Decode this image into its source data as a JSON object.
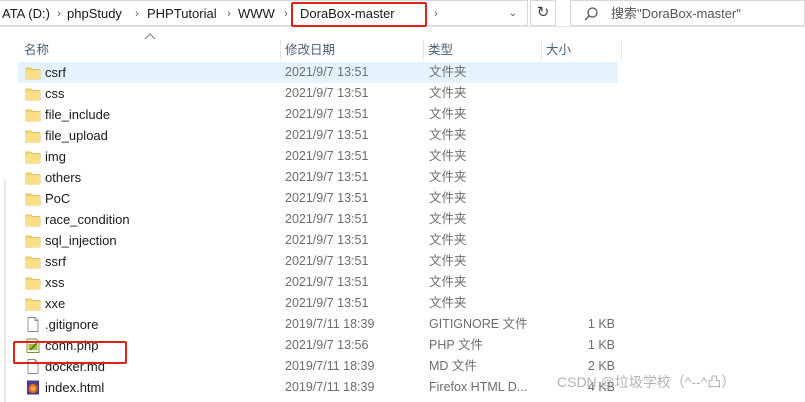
{
  "address": {
    "crumbs": [
      "ATA (D:)",
      "phpStudy",
      "PHPTutorial",
      "WWW",
      "DoraBox-master"
    ],
    "separator": "›",
    "dropdown": "⌄",
    "refresh": "↻"
  },
  "search": {
    "placeholder": "搜索\"DoraBox-master\""
  },
  "columns": {
    "name": "名称",
    "date": "修改日期",
    "type": "类型",
    "size": "大小"
  },
  "files": [
    {
      "name": "csrf",
      "date": "2021/9/7 13:51",
      "type": "文件夹",
      "size": "",
      "icon": "folder-icon"
    },
    {
      "name": "css",
      "date": "2021/9/7 13:51",
      "type": "文件夹",
      "size": "",
      "icon": "folder-icon"
    },
    {
      "name": "file_include",
      "date": "2021/9/7 13:51",
      "type": "文件夹",
      "size": "",
      "icon": "folder-icon"
    },
    {
      "name": "file_upload",
      "date": "2021/9/7 13:51",
      "type": "文件夹",
      "size": "",
      "icon": "folder-icon"
    },
    {
      "name": "img",
      "date": "2021/9/7 13:51",
      "type": "文件夹",
      "size": "",
      "icon": "folder-icon"
    },
    {
      "name": "others",
      "date": "2021/9/7 13:51",
      "type": "文件夹",
      "size": "",
      "icon": "folder-icon"
    },
    {
      "name": "PoC",
      "date": "2021/9/7 13:51",
      "type": "文件夹",
      "size": "",
      "icon": "folder-icon"
    },
    {
      "name": "race_condition",
      "date": "2021/9/7 13:51",
      "type": "文件夹",
      "size": "",
      "icon": "folder-icon"
    },
    {
      "name": "sql_injection",
      "date": "2021/9/7 13:51",
      "type": "文件夹",
      "size": "",
      "icon": "folder-icon"
    },
    {
      "name": "ssrf",
      "date": "2021/9/7 13:51",
      "type": "文件夹",
      "size": "",
      "icon": "folder-icon"
    },
    {
      "name": "xss",
      "date": "2021/9/7 13:51",
      "type": "文件夹",
      "size": "",
      "icon": "folder-icon"
    },
    {
      "name": "xxe",
      "date": "2021/9/7 13:51",
      "type": "文件夹",
      "size": "",
      "icon": "folder-icon"
    },
    {
      "name": ".gitignore",
      "date": "2019/7/11 18:39",
      "type": "GITIGNORE 文件",
      "size": "1 KB",
      "icon": "file-icon"
    },
    {
      "name": "conn.php",
      "date": "2021/9/7 13:56",
      "type": "PHP 文件",
      "size": "1 KB",
      "icon": "php-file-icon"
    },
    {
      "name": "docker.md",
      "date": "2019/7/11 18:39",
      "type": "MD 文件",
      "size": "2 KB",
      "icon": "file-icon"
    },
    {
      "name": "index.html",
      "date": "2019/7/11 18:39",
      "type": "Firefox HTML D...",
      "size": "4 KB",
      "icon": "firefox-html-icon"
    }
  ],
  "watermark": "CSDN @垃圾学校（^--^凸）",
  "colors": {
    "highlight": "#e0201b",
    "hover": "#e5f3ff",
    "folder": "#f8d775",
    "header": "#4c607a"
  }
}
